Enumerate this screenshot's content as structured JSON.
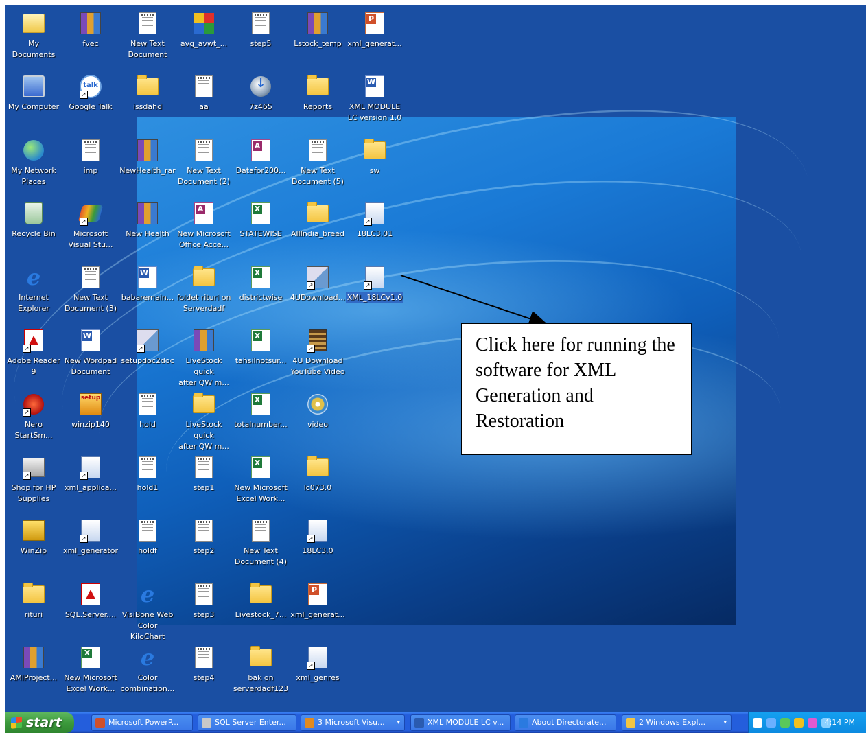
{
  "desktop": {
    "icons": [
      {
        "label": "My Documents",
        "glyph": "my-documents-icon"
      },
      {
        "label": "fvec",
        "glyph": "rar-archive-icon"
      },
      {
        "label": "New Text\nDocument",
        "glyph": "text-document-icon"
      },
      {
        "label": "avg_avwt_...",
        "glyph": "avg-installer-icon"
      },
      {
        "label": "step5",
        "glyph": "text-document-icon"
      },
      {
        "label": "Lstock_temp",
        "glyph": "rar-archive-icon"
      },
      {
        "label": "xml_generat...",
        "glyph": "powerpoint-icon"
      },
      {
        "label": "My Computer",
        "glyph": "my-computer-icon"
      },
      {
        "label": "Google Talk",
        "glyph": "google-talk-icon"
      },
      {
        "label": "issdahd",
        "glyph": "folder-icon"
      },
      {
        "label": "aa",
        "glyph": "text-document-icon"
      },
      {
        "label": "7z465",
        "glyph": "download-icon"
      },
      {
        "label": "Reports",
        "glyph": "folder-icon"
      },
      {
        "label": "XML MODULE\nLC version 1.0",
        "glyph": "word-document-icon"
      },
      {
        "label": "My Network\nPlaces",
        "glyph": "network-places-icon"
      },
      {
        "label": "imp",
        "glyph": "text-document-icon"
      },
      {
        "label": "NewHealth_rar",
        "glyph": "rar-archive-icon"
      },
      {
        "label": "New Text\nDocument (2)",
        "glyph": "text-document-icon"
      },
      {
        "label": "Datafor200...",
        "glyph": "access-database-icon"
      },
      {
        "label": "New Text\nDocument (5)",
        "glyph": "text-document-icon"
      },
      {
        "label": "sw",
        "glyph": "folder-icon"
      },
      {
        "label": "Recycle Bin",
        "glyph": "recycle-bin-icon"
      },
      {
        "label": "Microsoft\nVisual Stu...",
        "glyph": "visual-studio-icon"
      },
      {
        "label": "New Health",
        "glyph": "rar-archive-icon"
      },
      {
        "label": "New Microsoft\nOffice Acce...",
        "glyph": "access-database-icon"
      },
      {
        "label": "STATEWISE",
        "glyph": "excel-icon"
      },
      {
        "label": "AllIndia_breed",
        "glyph": "folder-icon"
      },
      {
        "label": "18LC3.01",
        "glyph": "executable-icon"
      },
      {
        "label": "Internet\nExplorer",
        "glyph": "internet-explorer-icon"
      },
      {
        "label": "New Text\nDocument (3)",
        "glyph": "text-document-icon"
      },
      {
        "label": "babaremain...",
        "glyph": "word-document-icon"
      },
      {
        "label": "foldet rituri on\nServerdadf",
        "glyph": "folder-icon"
      },
      {
        "label": "districtwise",
        "glyph": "excel-icon"
      },
      {
        "label": "4UDownload...",
        "glyph": "installer-icon"
      },
      {
        "label": "XML_18LCv1.0",
        "glyph": "executable-icon"
      },
      {
        "label": "Adobe Reader\n9",
        "glyph": "adobe-reader-icon"
      },
      {
        "label": "New Wordpad\nDocument",
        "glyph": "word-document-icon"
      },
      {
        "label": "setupdoc2doc",
        "glyph": "installer-icon"
      },
      {
        "label": "LiveStock quick\nafter QW m...",
        "glyph": "rar-archive-icon"
      },
      {
        "label": "tahsilnotsur...",
        "glyph": "excel-icon"
      },
      {
        "label": "4U Download\nYouTube Video",
        "glyph": "video-file-icon"
      },
      {
        "label": "Nero\nStartSm...",
        "glyph": "nero-icon"
      },
      {
        "label": "winzip140",
        "glyph": "setup-icon"
      },
      {
        "label": "hold",
        "glyph": "text-document-icon"
      },
      {
        "label": "LiveStock quick\nafter QW m...",
        "glyph": "folder-icon"
      },
      {
        "label": "totalnumber...",
        "glyph": "excel-icon"
      },
      {
        "label": "video",
        "glyph": "media-disc-icon"
      },
      {
        "label": "Shop for HP\nSupplies",
        "glyph": "printer-icon"
      },
      {
        "label": "xml_applica...",
        "glyph": "executable-icon"
      },
      {
        "label": "hold1",
        "glyph": "text-document-icon"
      },
      {
        "label": "step1",
        "glyph": "text-document-icon"
      },
      {
        "label": "New Microsoft\nExcel Work...",
        "glyph": "excel-icon"
      },
      {
        "label": "lc073.0",
        "glyph": "folder-icon"
      },
      {
        "label": "WinZip",
        "glyph": "winzip-icon"
      },
      {
        "label": "xml_generator",
        "glyph": "executable-icon"
      },
      {
        "label": "holdf",
        "glyph": "text-document-icon"
      },
      {
        "label": "step2",
        "glyph": "text-document-icon"
      },
      {
        "label": "New Text\nDocument (4)",
        "glyph": "text-document-icon"
      },
      {
        "label": "18LC3.0",
        "glyph": "executable-icon"
      },
      {
        "label": "rituri",
        "glyph": "folder-icon"
      },
      {
        "label": "SQL.Server....",
        "glyph": "pdf-icon"
      },
      {
        "label": "VisiBone Web\nColor KiloChart",
        "glyph": "internet-explorer-icon"
      },
      {
        "label": "step3",
        "glyph": "text-document-icon"
      },
      {
        "label": "Livestock_7...",
        "glyph": "folder-icon"
      },
      {
        "label": "xml_generat...",
        "glyph": "powerpoint-icon"
      },
      {
        "label": "AMIProject...",
        "glyph": "rar-archive-icon"
      },
      {
        "label": "New Microsoft\nExcel Work...",
        "glyph": "excel-icon"
      },
      {
        "label": "Color\ncombination...",
        "glyph": "internet-explorer-icon"
      },
      {
        "label": "step4",
        "glyph": "text-document-icon"
      },
      {
        "label": "bak on\nserverdadf123",
        "glyph": "folder-icon"
      },
      {
        "label": "xml_genres",
        "glyph": "executable-icon"
      }
    ],
    "selected_label": "XML_18LCv1.0"
  },
  "callout": {
    "text": "Click here for running the software for XML Generation and Restoration"
  },
  "taskbar": {
    "start_label": "start",
    "buttons": [
      {
        "label": "Microsoft PowerP...",
        "icon": "powerpoint-icon",
        "color": "#d0502a"
      },
      {
        "label": "SQL Server Enter...",
        "icon": "sql-server-icon",
        "color": "#c8c8c8"
      },
      {
        "label": "3 Microsoft Visu...",
        "icon": "visual-studio-icon",
        "color": "#e08a20"
      },
      {
        "label": "XML MODULE LC v...",
        "icon": "word-document-icon",
        "color": "#2a5bb0"
      },
      {
        "label": "About Directorate...",
        "icon": "internet-explorer-icon",
        "color": "#2a7ae0"
      },
      {
        "label": "2 Windows Expl...",
        "icon": "folder-icon",
        "color": "#f4c542"
      }
    ],
    "tray_icons": [
      "help-icon",
      "back-arrow-icon",
      "network-icon",
      "antivirus-icon",
      "activity-icon",
      "display-icon"
    ],
    "clock": "4:14 PM"
  },
  "colors": {
    "desktop_background": "#1a4fa3",
    "taskbar": "#245edc",
    "start_button": "#3c9a3c",
    "selection": "#316ac5"
  }
}
